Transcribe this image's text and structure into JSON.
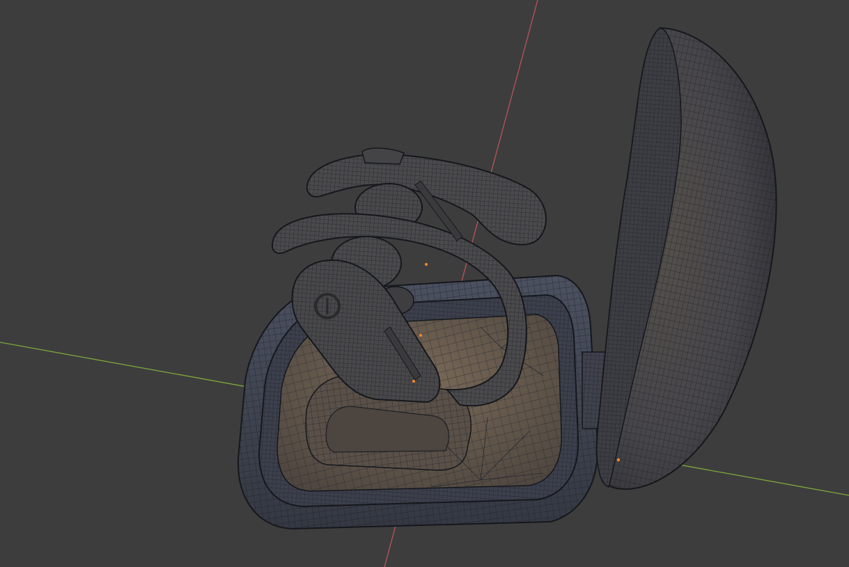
{
  "viewport": {
    "view": "3D Viewport",
    "shading": "wireframe-overlay-solid",
    "background_color": "#3d3d3d"
  },
  "axes": {
    "x_axis_color": "#7fa83a",
    "y_axis_color": "#b8555a"
  },
  "scene": {
    "objects": [
      {
        "name": "charging-case-base",
        "mesh": "wireframe"
      },
      {
        "name": "charging-case-lid",
        "mesh": "wireframe"
      },
      {
        "name": "earbud-back",
        "mesh": "wireframe"
      },
      {
        "name": "earbud-front",
        "mesh": "wireframe"
      }
    ],
    "mesh_base_color": "#4a4a4c",
    "wire_color": "#1a1c22",
    "interior_color": "#6b5e50",
    "vertex_highlight_color": "#ff8a1f"
  }
}
